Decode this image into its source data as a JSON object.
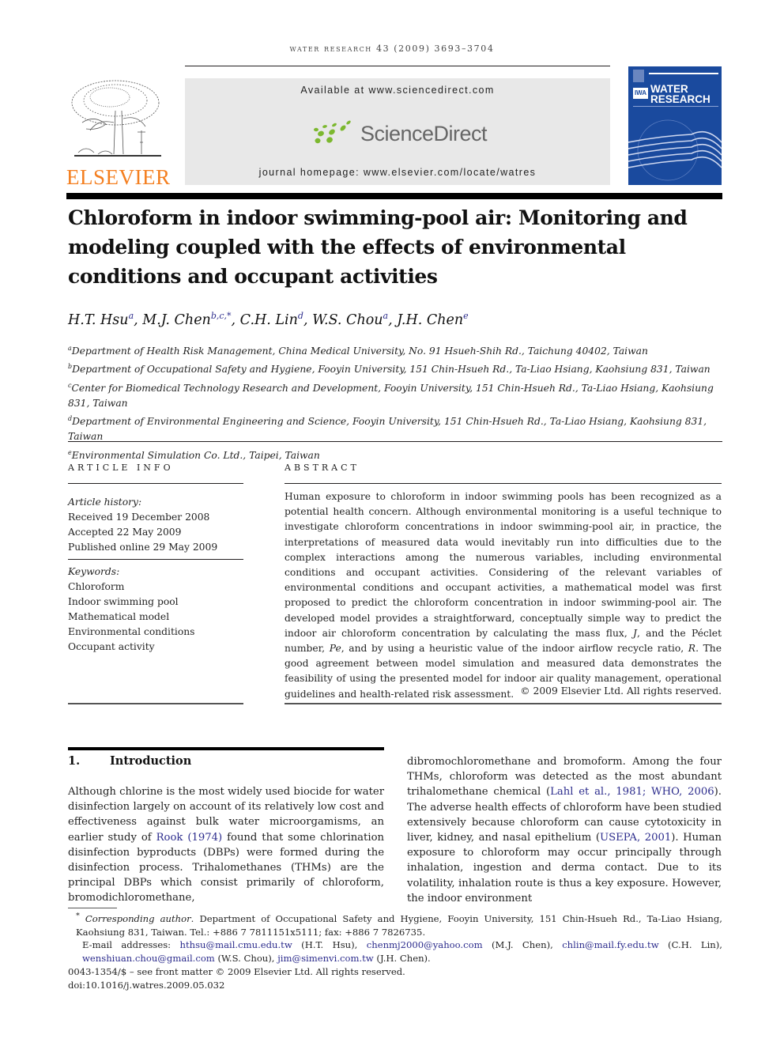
{
  "journal": {
    "running_head": "water research 43 (2009) 3693–3704",
    "publisher_wordmark": "ELSEVIER",
    "available_at": "Available at www.sciencedirect.com",
    "platform_name": "ScienceDirect",
    "homepage": "journal homepage: www.elsevier.com/locate/watres",
    "cover": {
      "badge": "IWA",
      "title_line1": "WATER",
      "title_line2": "RESEARCH"
    },
    "colors": {
      "elsevier_orange": "#f47f20",
      "sciencedirect_green": "#7cb82f",
      "cover_blue": "#1a4a9e",
      "link_blue": "#2b2b8c"
    }
  },
  "article": {
    "title": "Chloroform in indoor swimming-pool air: Monitoring and modeling coupled with the effects of environmental conditions and occupant activities",
    "authors": [
      {
        "name": "H.T. Hsu",
        "sup": "a"
      },
      {
        "name": "M.J. Chen",
        "sup": "b,c,*"
      },
      {
        "name": "C.H. Lin",
        "sup": "d"
      },
      {
        "name": "W.S. Chou",
        "sup": "a"
      },
      {
        "name": "J.H. Chen",
        "sup": "e"
      }
    ],
    "affiliations": [
      {
        "sup": "a",
        "text": "Department of Health Risk Management, China Medical University, No. 91 Hsueh-Shih Rd., Taichung 40402, Taiwan"
      },
      {
        "sup": "b",
        "text": "Department of Occupational Safety and Hygiene, Fooyin University, 151 Chin-Hsueh Rd., Ta-Liao Hsiang, Kaohsiung 831, Taiwan"
      },
      {
        "sup": "c",
        "text": "Center for Biomedical Technology Research and Development, Fooyin University, 151 Chin-Hsueh Rd., Ta-Liao Hsiang, Kaohsiung 831, Taiwan"
      },
      {
        "sup": "d",
        "text": "Department of Environmental Engineering and Science, Fooyin University, 151 Chin-Hsueh Rd., Ta-Liao Hsiang, Kaohsiung 831, Taiwan"
      },
      {
        "sup": "e",
        "text": "Environmental Simulation Co. Ltd., Taipei, Taiwan"
      }
    ]
  },
  "article_info": {
    "heading": "ARTICLE INFO",
    "history_label": "Article history:",
    "history": [
      "Received 19 December 2008",
      "Accepted 22 May 2009",
      "Published online 29 May 2009"
    ],
    "keywords_label": "Keywords:",
    "keywords": [
      "Chloroform",
      "Indoor swimming pool",
      "Mathematical model",
      "Environmental conditions",
      "Occupant activity"
    ]
  },
  "abstract": {
    "heading": "ABSTRACT",
    "part1": "Human exposure to chloroform in indoor swimming pools has been recognized as a potential health concern. Although environmental monitoring is a useful technique to investigate chloroform concentrations in indoor swimming-pool air, in practice, the interpretations of measured data would inevitably run into difficulties due to the complex interactions among the numerous variables, including environmental conditions and occupant activities. Considering of the relevant variables of environmental conditions and occupant activities, a mathematical model was first proposed to predict the chloroform concentration in indoor swimming-pool air. The developed model provides a straightforward, conceptually simple way to predict the indoor air chloroform concentration by calculating the mass flux, ",
    "sym_J": "J",
    "part2": ", and the Péclet number, ",
    "sym_Pe": "Pe",
    "part3": ", and by using a heuristic value of the indoor airflow recycle ratio, ",
    "sym_R": "R",
    "part4": ". The good agreement between model simulation and measured data demonstrates the feasibility of using the presented model for indoor air quality management, operational guidelines and health-related risk assessment.",
    "copyright": "© 2009 Elsevier Ltd. All rights reserved."
  },
  "introduction": {
    "number": "1.",
    "heading": "Introduction",
    "left_p1": "Although chlorine is the most widely used biocide for water disinfection largely on account of its relatively low cost and effectiveness against bulk water microorgamisms, an earlier study of ",
    "cite_rook": "Rook (1974)",
    "left_p2": " found that some chlorination disinfection byproducts (DBPs) were formed during the disinfection process. Trihalomethanes (THMs) are the principal DBPs which consist primarily of chloroform, bromodichloromethane,",
    "right_p1": "dibromochloromethane and bromoform. Among the four THMs, chloroform was detected as the most abundant trihalomethane chemical (",
    "cite_lahl": "Lahl et al., 1981; WHO, 2006",
    "right_p2": "). The adverse health effects of chloroform have been studied extensively because chloroform can cause cytotoxicity in liver, kidney, and nasal epithelium (",
    "cite_usepa": "USEPA, 2001",
    "right_p3": "). Human exposure to chloroform may occur principally through inhalation, ingestion and derma contact. Due to its volatility, inhalation route is thus a key exposure. However, the indoor environment"
  },
  "footnotes": {
    "star": "*",
    "corr_label": "Corresponding author",
    "corr_text": ". Department of Occupational Safety and Hygiene, Fooyin University, 151 Chin-Hsueh Rd., Ta-Liao Hsiang, Kaohsiung 831, Taiwan. Tel.: +886 7 7811151x5111; fax: +886 7 7826735.",
    "email_label": "E-mail addresses: ",
    "emails": [
      {
        "address": "hthsu@mail.cmu.edu.tw",
        "owner": " (H.T. Hsu), "
      },
      {
        "address": "chenmj2000@yahoo.com",
        "owner": " (M.J. Chen), "
      },
      {
        "address": "chlin@mail.fy.edu.tw",
        "owner": " (C.H. Lin), "
      },
      {
        "address": "wenshiuan.chou@gmail.com",
        "owner": " (W.S. Chou), "
      },
      {
        "address": "jim@simenvi.com.tw",
        "owner": " (J.H. Chen)."
      }
    ],
    "issn": "0043-1354/$ – see front matter © 2009 Elsevier Ltd. All rights reserved.",
    "doi": "doi:10.1016/j.watres.2009.05.032"
  }
}
